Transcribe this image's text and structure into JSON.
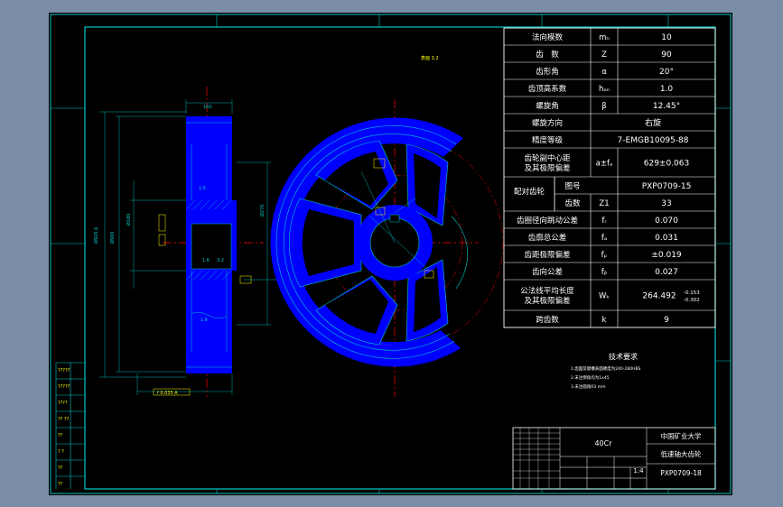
{
  "params": [
    {
      "name": "法向模数",
      "sym": "mₙ",
      "val": "10"
    },
    {
      "name": "齿　数",
      "sym": "Z",
      "val": "90"
    },
    {
      "name": "齿形角",
      "sym": "α",
      "val": "20°"
    },
    {
      "name": "齿顶高系数",
      "sym": "hₐₙ",
      "val": "1.0"
    },
    {
      "name": "螺旋角",
      "sym": "β",
      "val": "12.45°"
    },
    {
      "name": "螺旋方向",
      "sym": "",
      "val": "右旋"
    },
    {
      "name": "精度等级",
      "sym": "",
      "val": "7-EMGB10095-88"
    },
    {
      "name": "齿轮副中心距\n及其极限偏差",
      "sym": "a±fₐ",
      "val": "629±0.063"
    },
    {
      "name": "配对齿轮",
      "sym": "图号",
      "val": "PXP0709-15"
    },
    {
      "name": "",
      "sym": "齿数",
      "val": "33",
      "sym2": "Z1"
    },
    {
      "name": "齿圈径向跳动公差",
      "sym": "fᵣ",
      "val": "0.070"
    },
    {
      "name": "齿廓总公差",
      "sym": "fₐ",
      "val": "0.031"
    },
    {
      "name": "齿距极限偏差",
      "sym": "fₚ",
      "val": "±0.019"
    },
    {
      "name": "齿向公差",
      "sym": "fᵦ",
      "val": "0.027"
    },
    {
      "name": "公法线平均长度\n及其极限偏差",
      "sym": "Wₖ",
      "val": "264.492"
    },
    {
      "name": "跨齿数",
      "sym": "k",
      "val": "9"
    }
  ],
  "wk_tol": {
    "upper": "-0.153",
    "lower": "-0.302"
  },
  "tech": {
    "title": "技术要求",
    "lines": [
      "1.齿面及键槽表面硬度为240-280HBS",
      "2.未注倒角均为1x45",
      "3.未注圆角R3 mm"
    ]
  },
  "title_block": {
    "material": "40Cr",
    "school": "中国矿业大学",
    "part": "低速轴大齿轮",
    "drawing_no": "PXP0709-18",
    "scale": "1:4"
  },
  "colors": {
    "bg": "#000000",
    "line": "#00c8c8",
    "gear": "#0000ff",
    "center": "#ff0000",
    "dim": "#00b0b0",
    "text": "#ffffff",
    "note": "#ffff00"
  }
}
